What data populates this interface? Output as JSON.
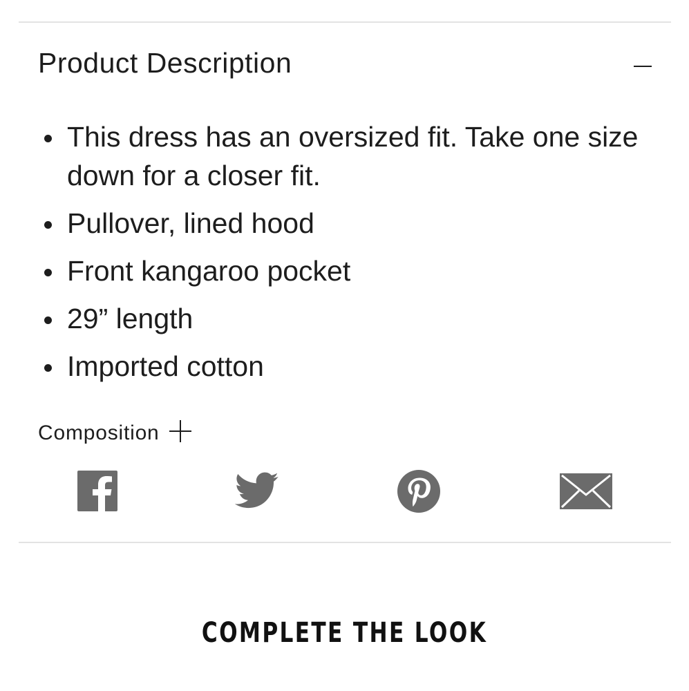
{
  "description_section": {
    "title": "Product Description",
    "toggle_icon": "minus-icon",
    "bullets": [
      "This dress has an oversized fit. Take one size down for a closer fit.",
      "Pullover, lined hood",
      "Front kangaroo pocket",
      "29” length",
      "Imported cotton"
    ]
  },
  "composition": {
    "label": "Composition",
    "toggle_icon": "plus-icon"
  },
  "share": {
    "icon_color": "#6b6b6b",
    "icons": [
      "facebook-icon",
      "twitter-icon",
      "pinterest-icon",
      "email-icon"
    ]
  },
  "complete_the_look": {
    "title": "COMPLETE THE LOOK"
  }
}
